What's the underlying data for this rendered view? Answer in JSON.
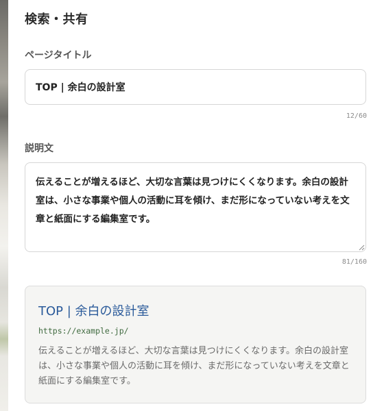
{
  "panel": {
    "title": "検索・共有"
  },
  "page_title_field": {
    "label": "ページタイトル",
    "value": "TOP | 余白の設計室",
    "counter": "12/60"
  },
  "description_field": {
    "label": "説明文",
    "value": "伝えることが増えるほど、大切な言葉は見つけにくくなります。余白の設計室は、小さな事業や個人の活動に耳を傾け、まだ形になっていない考えを文章と紙面にする編集室です。",
    "counter": "81/160"
  },
  "search_preview": {
    "title": "TOP | 余白の設計室",
    "url": "https://example.jp/",
    "description": "伝えることが増えるほど、大切な言葉は見つけにくくなります。余白の設計室は、小さな事業や個人の活動に耳を傾け、まだ形になっていない考えを文章と紙面にする編集室です。"
  },
  "colors": {
    "preview_title": "#2a5a9a",
    "preview_url": "#3f6a3f",
    "input_border": "#d6d6d6",
    "preview_background": "#f5f5f3"
  },
  "icons": {
    "resize": "resize-grip-icon"
  }
}
